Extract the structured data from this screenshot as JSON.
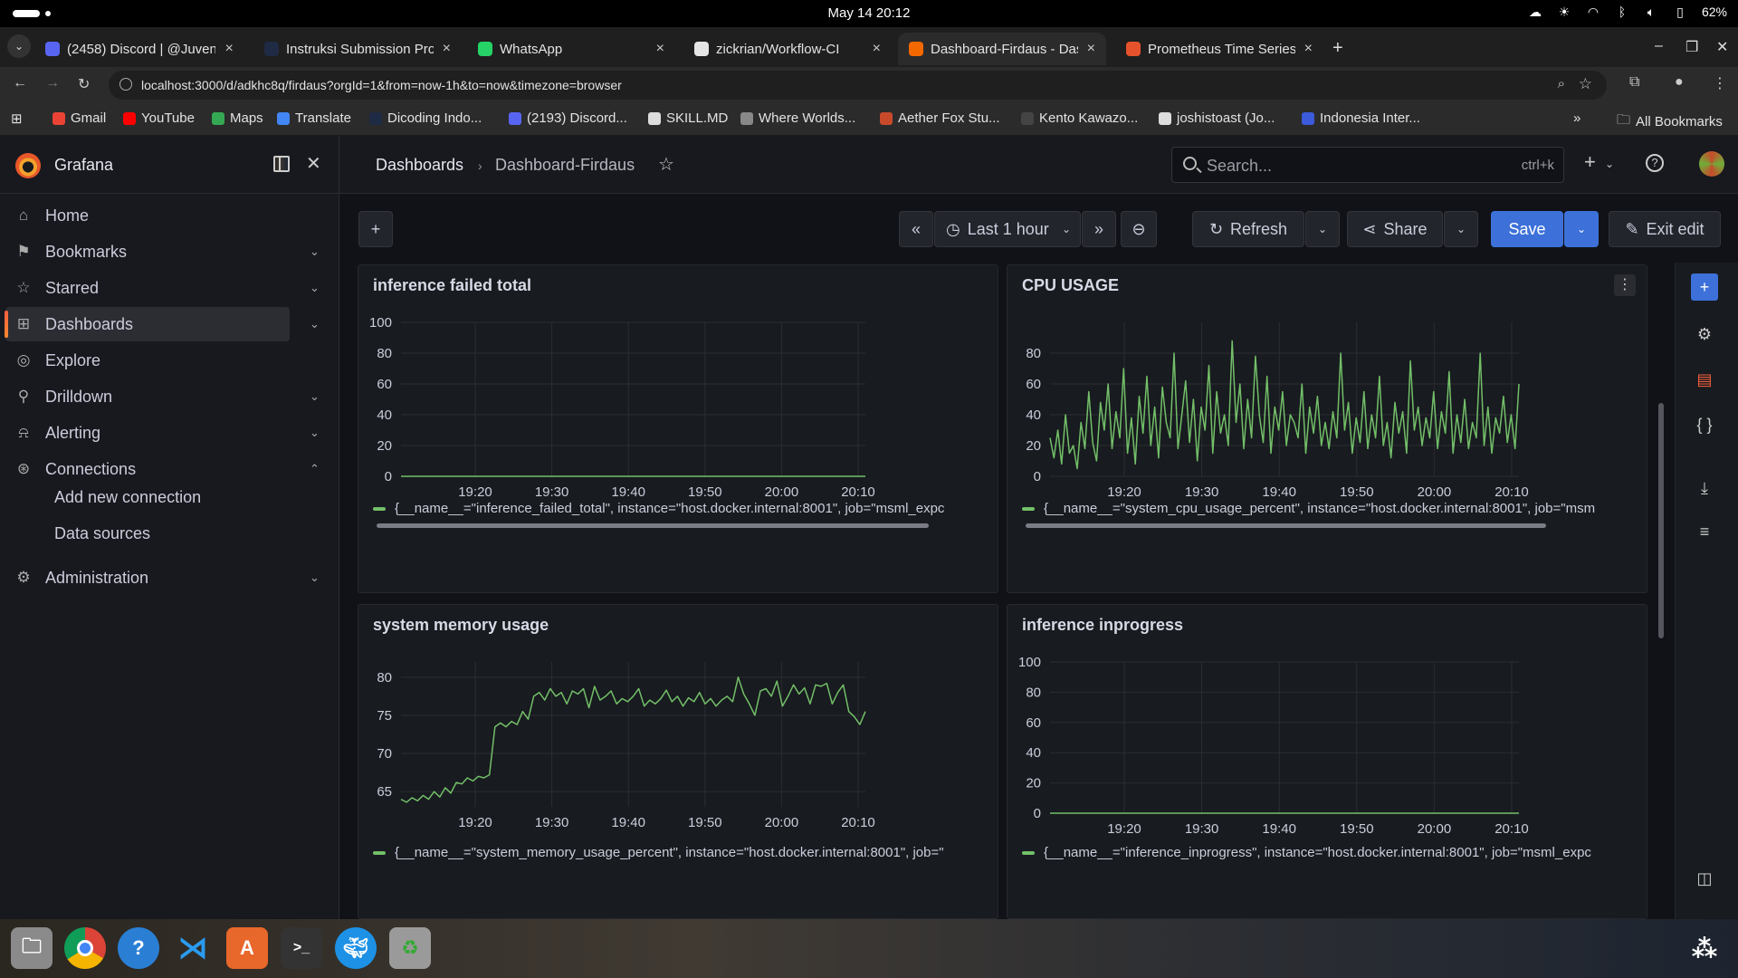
{
  "os": {
    "clock": "May 14  20:12",
    "battery": "62%"
  },
  "browser": {
    "tabs": [
      {
        "title": "(2458) Discord | @Juveni",
        "color": "#5865f2"
      },
      {
        "title": "Instruksi Submission Pro",
        "color": "#1f2a44"
      },
      {
        "title": "WhatsApp",
        "color": "#25d366"
      },
      {
        "title": "zickrian/Workflow-CI",
        "color": "#e6e6e6"
      },
      {
        "title": "Dashboard-Firdaus - Das",
        "color": "#f46800"
      },
      {
        "title": "Prometheus Time Series",
        "color": "#e6522c"
      }
    ],
    "url": "localhost:3000/d/adkhc8q/firdaus?orgId=1&from=now-1h&to=now&timezone=browser",
    "bookmarks": [
      "Gmail",
      "YouTube",
      "Maps",
      "Translate",
      "Dicoding Indo...",
      "(2193) Discord...",
      "SKILL.MD",
      "Where Worlds...",
      "Aether Fox Stu...",
      "Kento Kawazo...",
      "joshistoast (Jo...",
      "Indonesia Inter..."
    ],
    "all_bookmarks": "All Bookmarks"
  },
  "grafana": {
    "brand": "Grafana",
    "nav": [
      {
        "label": "Home",
        "icon": "home-icon",
        "chevron": ""
      },
      {
        "label": "Bookmarks",
        "icon": "bookmark-icon",
        "chevron": "⌄"
      },
      {
        "label": "Starred",
        "icon": "star-icon",
        "chevron": "⌄"
      },
      {
        "label": "Dashboards",
        "icon": "apps-icon",
        "chevron": "⌄"
      },
      {
        "label": "Explore",
        "icon": "compass-icon",
        "chevron": ""
      },
      {
        "label": "Drilldown",
        "icon": "drilldown-icon",
        "chevron": "⌄"
      },
      {
        "label": "Alerting",
        "icon": "bell-icon",
        "chevron": "⌄"
      },
      {
        "label": "Connections",
        "icon": "connections-icon",
        "chevron": "⌃"
      },
      {
        "label": "Administration",
        "icon": "gear-icon",
        "chevron": "⌄"
      }
    ],
    "nav_sub": [
      "Add new connection",
      "Data sources"
    ],
    "breadcrumb": [
      "Dashboards",
      "Dashboard-Firdaus"
    ],
    "search_placeholder": "Search...",
    "search_shortcut": "ctrl+k",
    "toolbar": {
      "time_range": "Last 1 hour",
      "refresh": "Refresh",
      "share": "Share",
      "save": "Save",
      "exit_edit": "Exit edit"
    },
    "accent": "#3d71d9",
    "series_color": "#73bf69"
  },
  "chart_data": [
    {
      "type": "line",
      "title": "inference failed total",
      "x_ticks": [
        "19:20",
        "19:30",
        "19:40",
        "19:50",
        "20:00",
        "20:10"
      ],
      "ylim": [
        0,
        100
      ],
      "y_ticks": [
        0,
        20,
        40,
        60,
        80,
        100
      ],
      "grid": true,
      "series": [
        {
          "name": "{__name__=\"inference_failed_total\", instance=\"host.docker.internal:8001\", job=\"msml_expc",
          "values": [
            0,
            0,
            0,
            0,
            0,
            0,
            0,
            0,
            0,
            0,
            0,
            0,
            0,
            0
          ]
        }
      ]
    },
    {
      "type": "line",
      "title": "CPU USAGE",
      "x_ticks": [
        "19:20",
        "19:30",
        "19:40",
        "19:50",
        "20:00",
        "20:10"
      ],
      "ylim": [
        0,
        100
      ],
      "y_ticks": [
        0,
        20,
        40,
        60,
        80
      ],
      "grid": true,
      "series": [
        {
          "name": "{__name__=\"system_cpu_usage_percent\", instance=\"host.docker.internal:8001\", job=\"msm",
          "values": [
            25,
            12,
            30,
            8,
            40,
            15,
            20,
            5,
            35,
            18,
            55,
            22,
            10,
            48,
            30,
            60,
            18,
            42,
            25,
            70,
            15,
            38,
            8,
            52,
            28,
            65,
            20,
            45,
            12,
            58,
            35,
            25,
            80,
            18,
            40,
            62,
            22,
            50,
            10,
            45,
            30,
            72,
            15,
            55,
            28,
            40,
            20,
            88,
            35,
            60,
            18,
            50,
            25,
            78,
            40,
            22,
            65,
            15,
            45,
            30,
            55,
            20,
            40,
            35,
            25,
            60,
            15,
            45,
            28,
            52,
            20,
            35,
            18,
            42,
            25,
            80,
            30,
            48,
            15,
            38,
            22,
            55,
            18,
            40,
            25,
            65,
            20,
            35,
            12,
            48,
            28,
            42,
            15,
            75,
            30,
            45,
            20,
            38,
            25,
            55,
            18,
            42,
            28,
            68,
            15,
            40,
            22,
            50,
            18,
            35,
            25,
            80,
            20,
            45,
            15,
            38,
            28,
            52,
            22,
            40,
            18,
            60
          ]
        }
      ]
    },
    {
      "type": "line",
      "title": "system memory usage",
      "x_ticks": [
        "19:20",
        "19:30",
        "19:40",
        "19:50",
        "20:00",
        "20:10"
      ],
      "ylim": [
        63,
        82
      ],
      "y_ticks": [
        65,
        70,
        75,
        80
      ],
      "grid": true,
      "series": [
        {
          "name": "{__name__=\"system_memory_usage_percent\", instance=\"host.docker.internal:8001\", job=\"",
          "values": [
            64,
            63.6,
            64.2,
            63.8,
            64.5,
            64,
            65,
            64.3,
            65.5,
            64.8,
            66.2,
            66,
            66.8,
            66.4,
            67,
            66.8,
            67.2,
            73.5,
            74,
            73.5,
            74.2,
            73.8,
            75.5,
            74.5,
            77.5,
            78,
            77,
            78.5,
            77.5,
            78,
            76.5,
            78.2,
            77.8,
            78.5,
            76,
            78.8,
            77,
            77.5,
            78.2,
            76.5,
            77.2,
            76.8,
            77.5,
            78.5,
            76.2,
            77,
            76.5,
            77.2,
            78.3,
            76.8,
            77.5,
            76.2,
            77.3,
            76.8,
            78,
            76.5,
            77.2,
            76.2,
            77,
            77.5,
            76.8,
            80,
            77.8,
            76.5,
            75,
            78.2,
            78.5,
            77.5,
            79.5,
            76.2,
            77.5,
            79,
            77.8,
            78.6,
            76.5,
            79,
            78.8,
            79.2,
            76.5,
            78,
            79,
            75.5,
            74.8,
            73.8,
            75.5
          ]
        }
      ]
    },
    {
      "type": "line",
      "title": "inference inprogress",
      "x_ticks": [
        "19:20",
        "19:30",
        "19:40",
        "19:50",
        "20:00",
        "20:10"
      ],
      "ylim": [
        0,
        100
      ],
      "y_ticks": [
        0,
        20,
        40,
        60,
        80,
        100
      ],
      "grid": true,
      "series": [
        {
          "name": "{__name__=\"inference_inprogress\", instance=\"host.docker.internal:8001\", job=\"msml_expc",
          "values": [
            0,
            0,
            0,
            0,
            0,
            0,
            0,
            0,
            0,
            0,
            0,
            0,
            0,
            0
          ]
        }
      ]
    }
  ]
}
